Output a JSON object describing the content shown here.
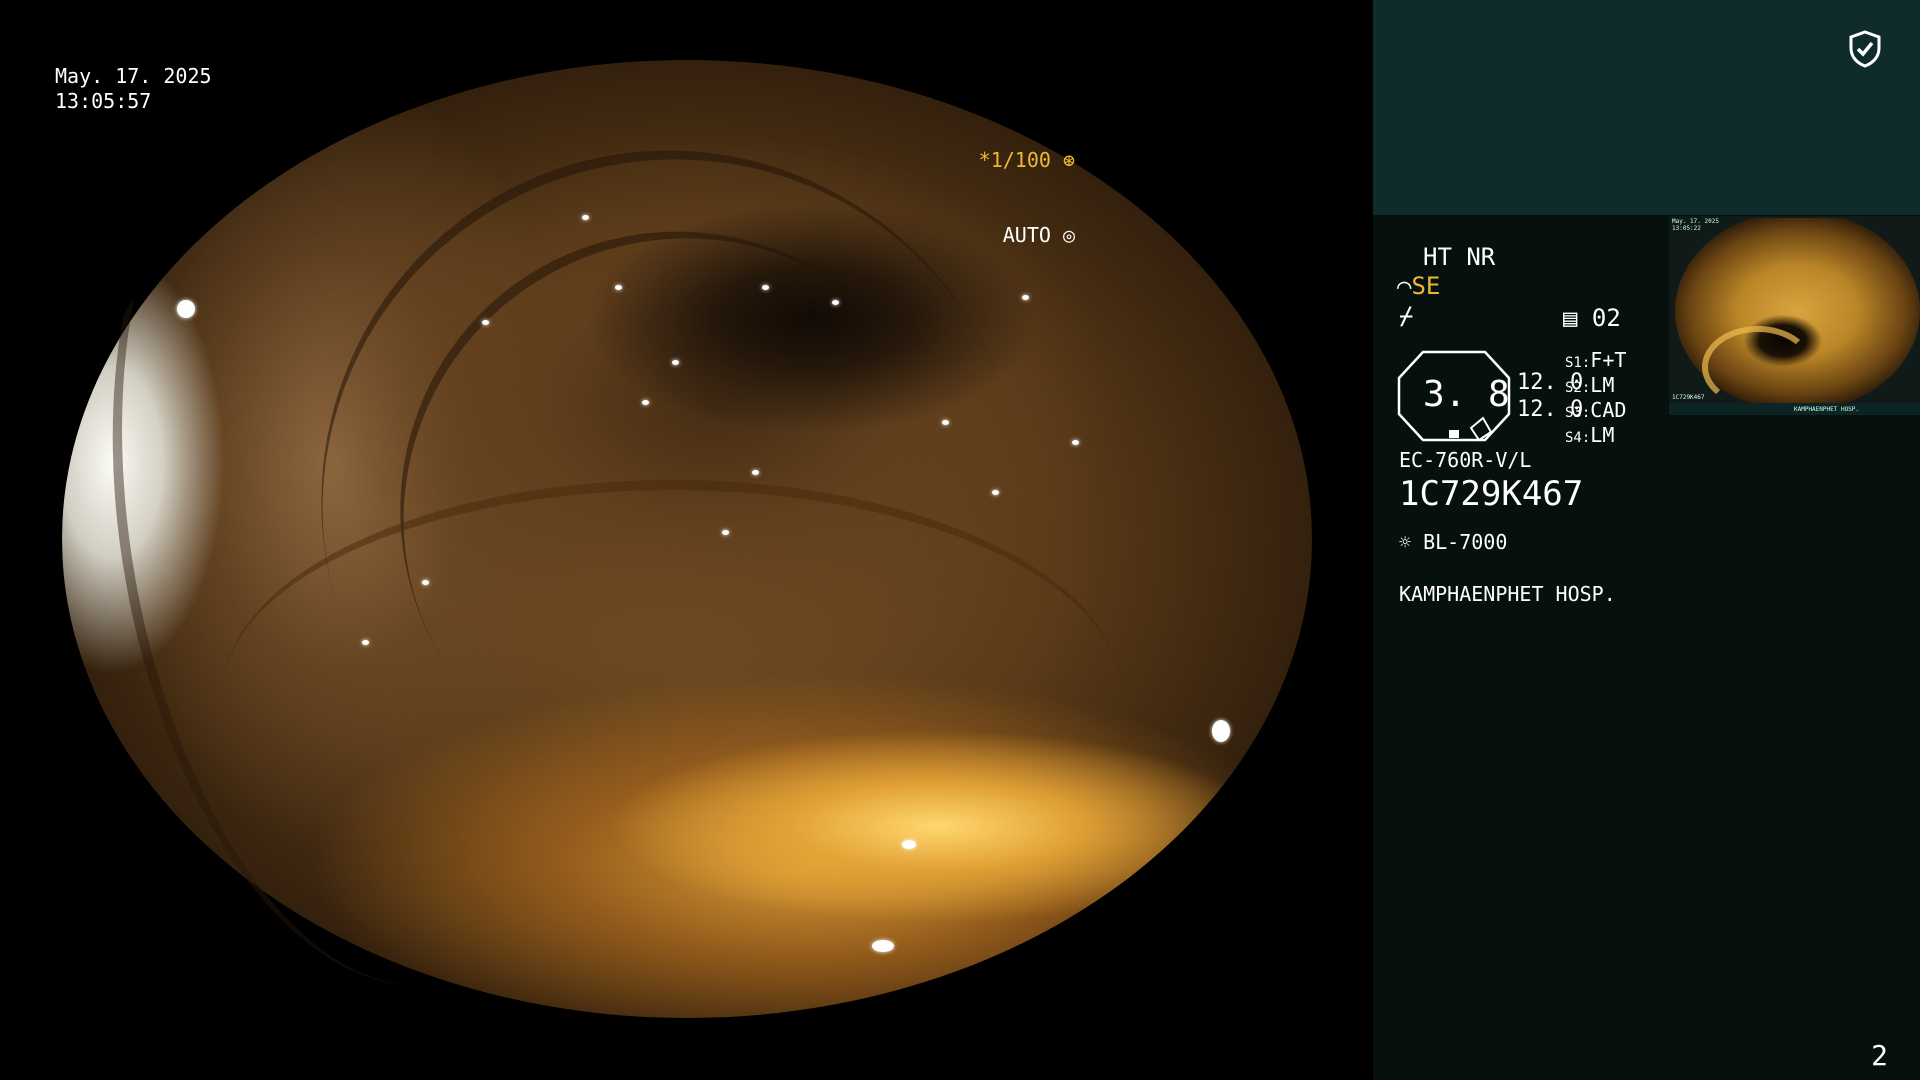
{
  "overlay": {
    "date": "May. 17. 2025",
    "time": "13:05:57",
    "shutter": "*1/100",
    "mode": "AUTO"
  },
  "panel": {
    "ht_nr": "HT NR",
    "se": "SE",
    "preset_number": "02",
    "enhancement_value": "3. 8",
    "value_1": "12. 0",
    "value_2": "12. 0",
    "switches": [
      {
        "key": "S1:",
        "value": "F+T"
      },
      {
        "key": "S2:",
        "value": "LM"
      },
      {
        "key": "S3:",
        "value": "CAD"
      },
      {
        "key": "S4:",
        "value": "LM"
      }
    ],
    "scope_model": "EC-760R-V/L",
    "scope_serial": "1C729K467",
    "light_source": "BL-7000",
    "hospital": "KAMPHAENPHET HOSP.",
    "page_number": "2"
  },
  "thumbnail": {
    "date": "May. 17. 2025",
    "time": "13:05:22",
    "serial": "1C729K467",
    "hospital": "KAMPHAENPHET HOSP."
  },
  "colors": {
    "accent": "#f0b830",
    "panel_top": "#0f2b2b",
    "panel_bg": "#06100f"
  },
  "icons": [
    "shield-check-icon",
    "scope-tip-icon",
    "freeze-icon",
    "preset-icon",
    "light-source-icon",
    "shutter-icon",
    "auto-iris-icon"
  ]
}
